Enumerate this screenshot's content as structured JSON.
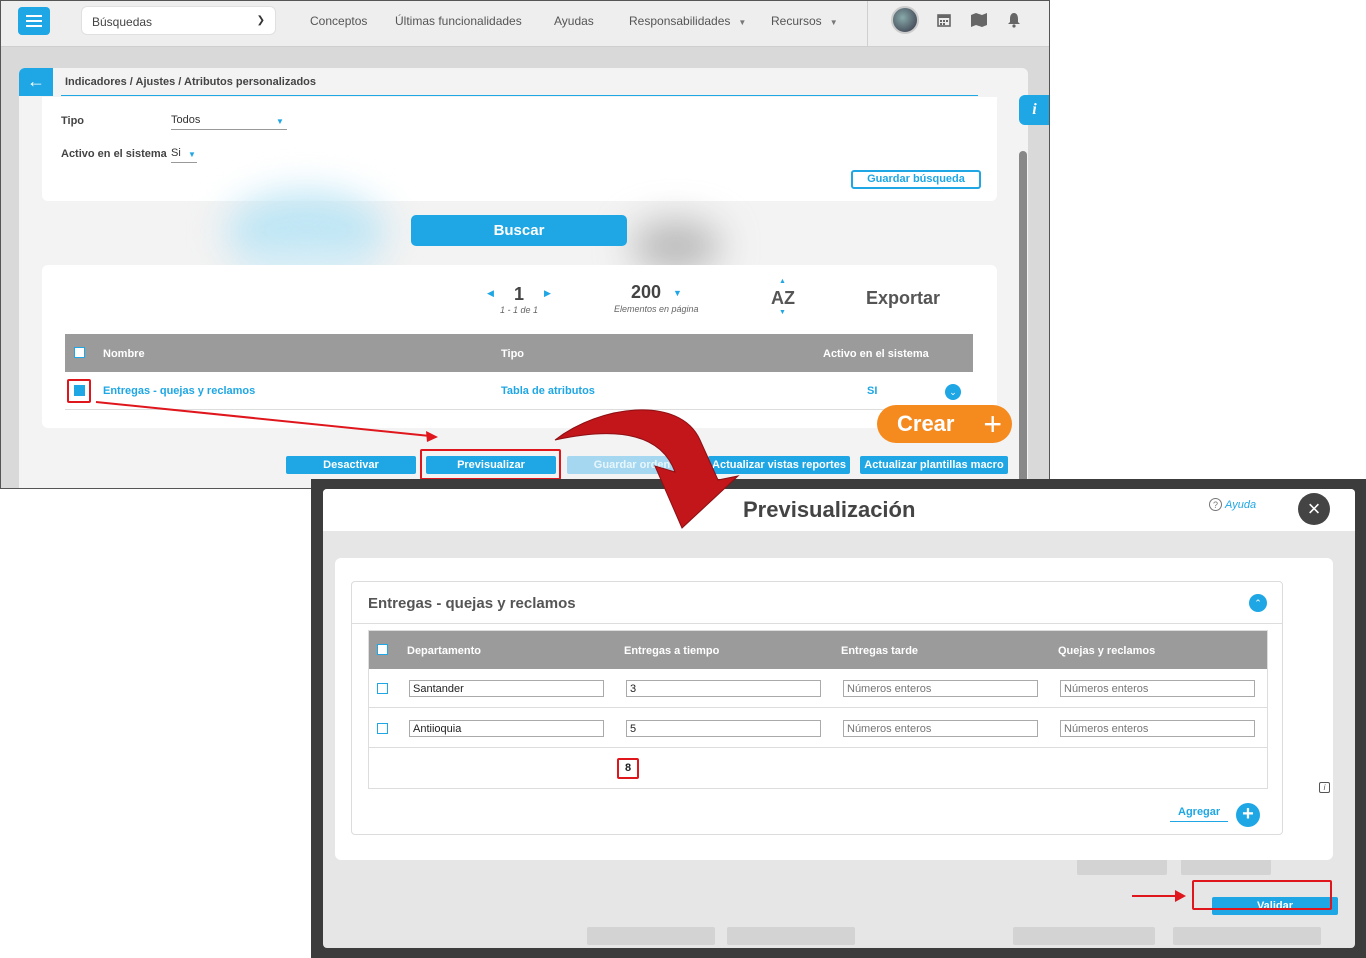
{
  "topbar": {
    "search_select": "Búsquedas",
    "nav": [
      "Conceptos",
      "Últimas funcionalidades",
      "Ayudas",
      "Responsabilidades",
      "Recursos"
    ]
  },
  "page": {
    "breadcrumb": "Indicadores / Ajustes / Atributos personalizados",
    "info_label": "i"
  },
  "filters": {
    "tipo_label": "Tipo",
    "tipo_value": "Todos",
    "activo_label": "Activo en el sistema",
    "activo_value": "Si",
    "save_search": "Guardar búsqueda",
    "search_button": "Buscar"
  },
  "pager": {
    "page": "1",
    "range": "1 - 1 de 1",
    "per_page": "200",
    "per_page_label": "Elementos en página",
    "sort_label": "AZ",
    "export_label": "Exportar"
  },
  "results": {
    "headers": [
      "Nombre",
      "Tipo",
      "Activo en el sistema"
    ],
    "rows": [
      {
        "name": "Entregas - quejas y reclamos",
        "type": "Tabla de atributos",
        "active": "SI"
      }
    ]
  },
  "crear": {
    "label": "Crear",
    "plus": "+"
  },
  "actions": {
    "deactivate": "Desactivar",
    "preview": "Previsualizar",
    "save_order": "Guardar orden",
    "update_views": "Actualizar vistas reportes",
    "update_templates": "Actualizar plantillas macro"
  },
  "modal": {
    "title": "Previsualización",
    "help": "Ayuda",
    "close": "×",
    "section_title": "Entregas - quejas y reclamos",
    "headers": [
      "Departamento",
      "Entregas a tiempo",
      "Entregas tarde",
      "Quejas y reclamos"
    ],
    "rows": [
      {
        "dept": "Santander",
        "on_time": "3",
        "late_placeholder": "Números enteros",
        "complaints_placeholder": "Números enteros"
      },
      {
        "dept": "Antiioquia",
        "on_time": "5",
        "late_placeholder": "Números enteros",
        "complaints_placeholder": "Números enteros"
      }
    ],
    "total": "8",
    "add_label": "Agregar",
    "add_plus": "+",
    "validate": "Validar"
  },
  "colors": {
    "accent": "#1ea7e4",
    "highlight": "#e0161d",
    "crear": "#f58a1f"
  }
}
